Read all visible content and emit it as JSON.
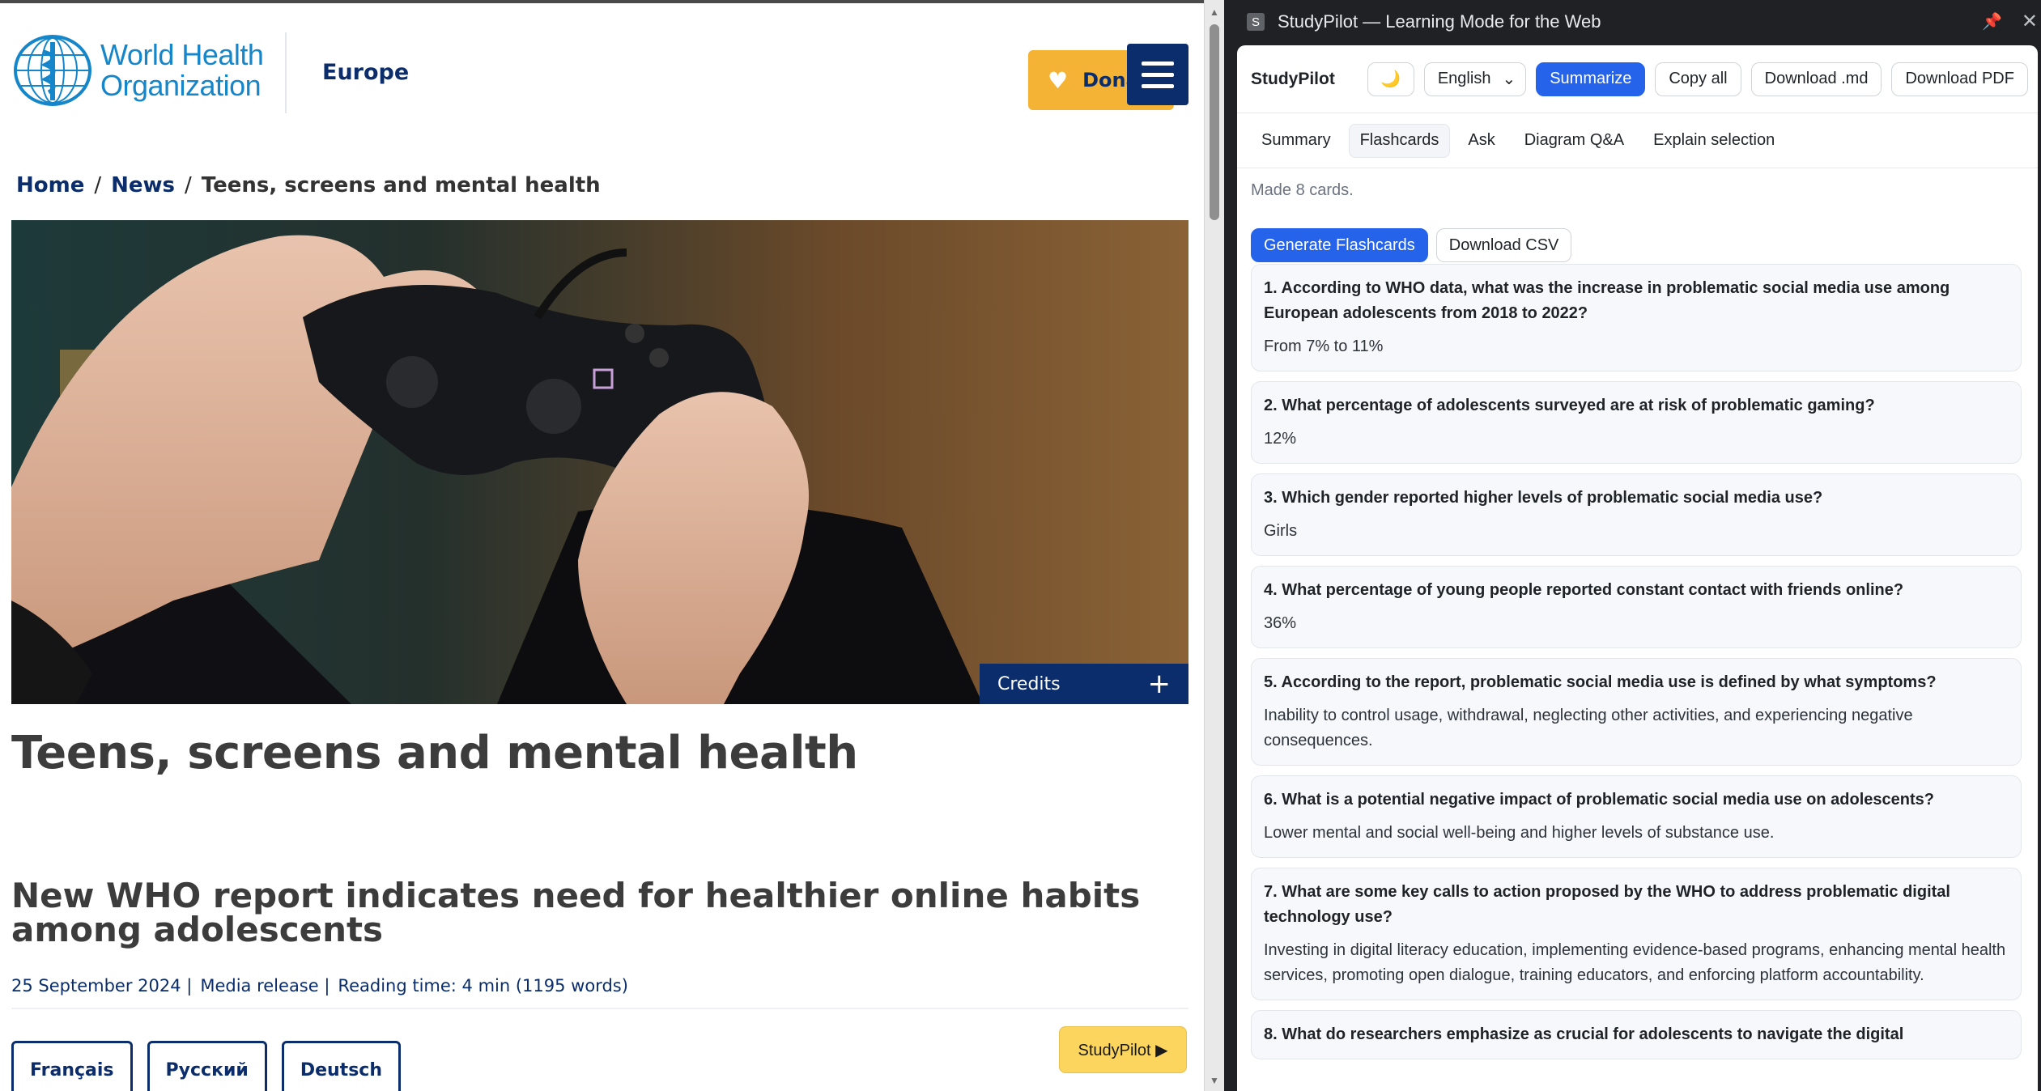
{
  "site": {
    "logo_line1": "World Health",
    "logo_line2": "Organization",
    "region": "Europe",
    "donate_label": "Donate",
    "breadcrumb": {
      "home": "Home",
      "news": "News",
      "current": "Teens, screens and mental health"
    },
    "hero_credits": "Credits",
    "title": "Teens, screens and mental health",
    "subtitle": "New WHO report indicates need for healthier online habits among adolescents",
    "meta": {
      "date": "25 September 2024 |",
      "type": "Media release |",
      "reading": "Reading time: 4 min (1195 words)"
    },
    "languages": [
      "Français",
      "Русский",
      "Deutsch"
    ],
    "studypilot_launch": "StudyPilot ▶"
  },
  "panel": {
    "window_title": "StudyPilot — Learning Mode for the Web",
    "favicon_letter": "S",
    "brand": "StudyPilot",
    "language_selected": "English",
    "toolbar": {
      "summarize": "Summarize",
      "copy_all": "Copy all",
      "download_md": "Download .md",
      "download_pdf": "Download PDF"
    },
    "tabs": [
      "Summary",
      "Flashcards",
      "Ask",
      "Diagram Q&A",
      "Explain selection"
    ],
    "active_tab": "Flashcards",
    "status": "Made 8 cards.",
    "generate_label": "Generate Flashcards",
    "download_csv_label": "Download CSV",
    "cards": [
      {
        "q": "1. According to WHO data, what was the increase in problematic social media use among European adolescents from 2018 to 2022?",
        "a": "From 7% to 11%"
      },
      {
        "q": "2. What percentage of adolescents surveyed are at risk of problematic gaming?",
        "a": "12%"
      },
      {
        "q": "3. Which gender reported higher levels of problematic social media use?",
        "a": "Girls"
      },
      {
        "q": "4. What percentage of young people reported constant contact with friends online?",
        "a": "36%"
      },
      {
        "q": "5. According to the report, problematic social media use is defined by what symptoms?",
        "a": "Inability to control usage, withdrawal, neglecting other activities, and experiencing negative consequences."
      },
      {
        "q": "6. What is a potential negative impact of problematic social media use on adolescents?",
        "a": "Lower mental and social well-being and higher levels of substance use."
      },
      {
        "q": "7. What are some key calls to action proposed by the WHO to address problematic digital technology use?",
        "a": "Investing in digital literacy education, implementing evidence-based programs, enhancing mental health services, promoting open dialogue, training educators, and enforcing platform accountability."
      },
      {
        "q": "8. What do researchers emphasize as crucial for adolescents to navigate the digital",
        "a": ""
      }
    ]
  },
  "colors": {
    "who_blue": "#1486c9",
    "who_navy": "#0b2d6b",
    "donate_yellow": "#f5b335",
    "accent_blue": "#2563eb",
    "panel_dark": "#202124"
  },
  "icons": [
    "who-emblem-icon",
    "heart-icon",
    "hamburger-icon",
    "plus-icon",
    "moon-icon",
    "chevron-down-icon",
    "pin-icon",
    "close-icon"
  ]
}
